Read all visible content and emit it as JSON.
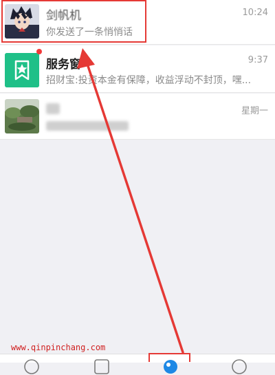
{
  "chats": [
    {
      "name": "剑帆机",
      "preview": "你发送了一条悄悄话",
      "time": "10:24",
      "avatar": "anime-character-avatar"
    },
    {
      "name": "服务窗",
      "preview": "招财宝:投资本金有保障，收益浮动不封顶，嘿...",
      "time": "9:37",
      "avatar": "service-window-star-icon",
      "unread": true
    },
    {
      "name": "",
      "preview": "",
      "time": "星期一",
      "avatar": "landscape-photo-avatar"
    }
  ],
  "watermark": "www.qinpinchang.com",
  "tabbar": {
    "icons": [
      "home-icon",
      "list-icon",
      "friends-icon",
      "profile-icon"
    ],
    "active_index": 2
  },
  "colors": {
    "annotation_red": "#e53935",
    "service_green": "#1fc088",
    "unread_red": "#f23a3a",
    "active_tab_blue": "#1e88e5"
  }
}
